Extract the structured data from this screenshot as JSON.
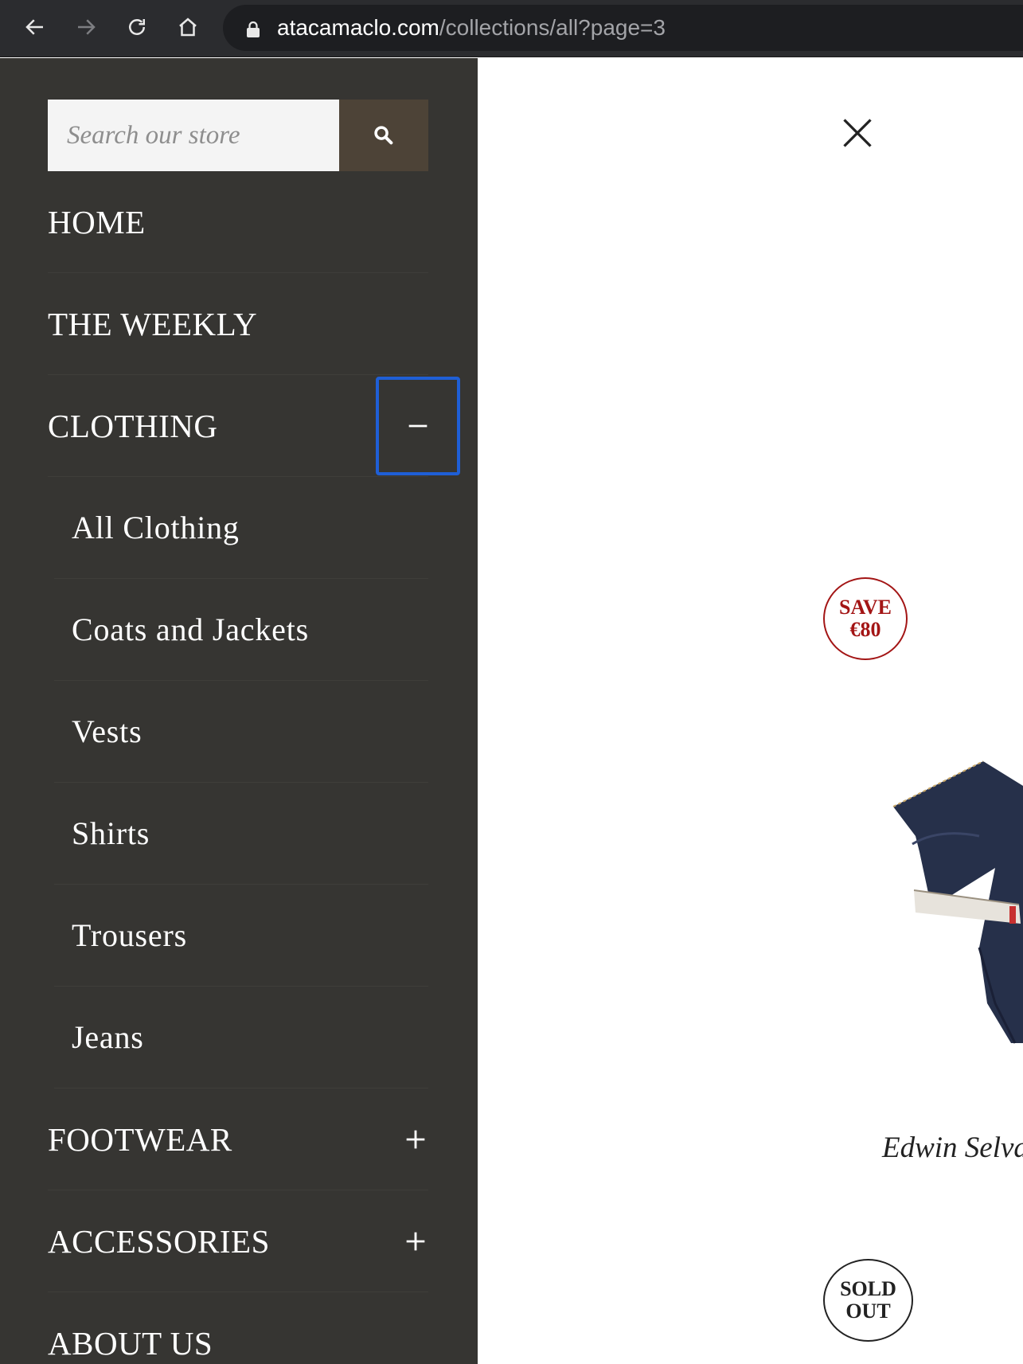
{
  "browser": {
    "url_host": "atacamaclo.com",
    "url_path": "/collections/all?page=3"
  },
  "drawer": {
    "search": {
      "placeholder": "Search our store"
    },
    "menu": {
      "home": "HOME",
      "weekly": "THE WEEKLY",
      "clothing": "CLOTHING",
      "clothing_sub": [
        "All Clothing",
        "Coats and Jackets",
        "Vests",
        "Shirts",
        "Trousers",
        "Jeans"
      ],
      "footwear": "FOOTWEAR",
      "accessories": "ACCESSORIES",
      "about": "ABOUT US"
    }
  },
  "content": {
    "save_badge": {
      "line1": "SAVE",
      "line2": "€80"
    },
    "product_title": "Edwin Selva",
    "sold_badge": {
      "line1": "SOLD",
      "line2": "OUT"
    }
  },
  "colors": {
    "drawer_bg": "#363532",
    "search_button_bg": "#4d4337",
    "focus_ring": "#1f5fd6",
    "save_badge": "#a31515"
  }
}
